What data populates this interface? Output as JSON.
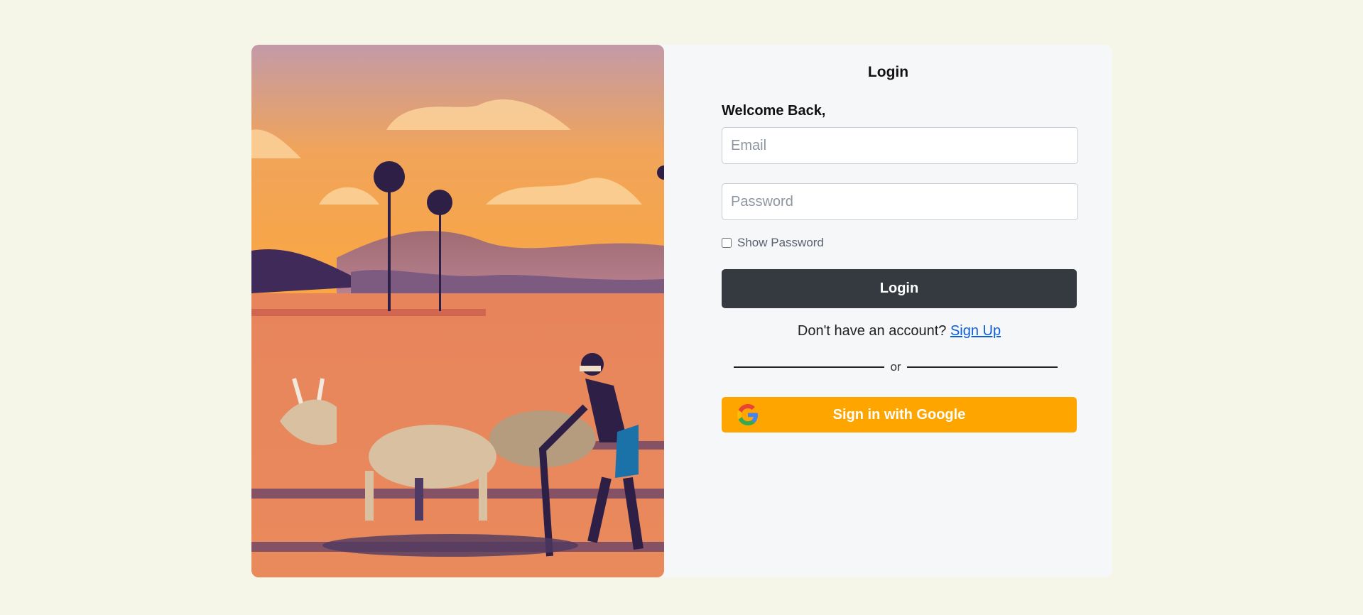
{
  "login_card": {
    "title": "Login",
    "welcome": "Welcome Back,",
    "email_placeholder": "Email",
    "password_placeholder": "Password",
    "show_password_label": "Show Password",
    "show_password_checked": false,
    "login_button": "Login",
    "no_account_text": "Don't have an account?",
    "signup_link": "Sign Up",
    "divider_text": "or",
    "google_button": "Sign in with Google"
  },
  "illustration": {
    "icon": "farmer-ploughing-with-oxen-illustration"
  },
  "colors": {
    "page_background": "#f5f6e8",
    "card_background": "#f6f7f8",
    "login_button": "#343a40",
    "google_button": "#ffa500",
    "link": "#0b5ed7"
  }
}
